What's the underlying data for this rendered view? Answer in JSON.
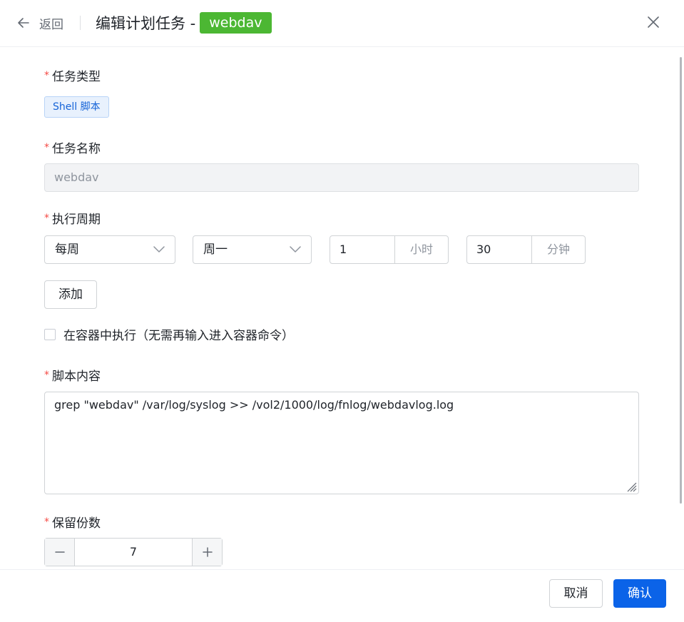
{
  "header": {
    "back_label": "返回",
    "title": "编辑计划任务 -",
    "task_tag": "webdav"
  },
  "form": {
    "task_type": {
      "label": "任务类型",
      "value": "Shell 脚本"
    },
    "task_name": {
      "label": "任务名称",
      "value": "webdav"
    },
    "schedule": {
      "label": "执行周期",
      "frequency": "每周",
      "weekday": "周一",
      "hour_value": "1",
      "hour_unit": "小时",
      "minute_value": "30",
      "minute_unit": "分钟",
      "add_label": "添加"
    },
    "container": {
      "label": "在容器中执行（无需再输入进入容器命令）",
      "checked": false
    },
    "script": {
      "label": "脚本内容",
      "value": "grep \"webdav\" /var/log/syslog >> /vol2/1000/log/fnlog/webdavlog.log"
    },
    "retention": {
      "label": "保留份数",
      "value": "7"
    }
  },
  "footer": {
    "cancel_label": "取消",
    "confirm_label": "确认"
  },
  "colors": {
    "primary": "#0b63e8",
    "tag_green": "#4cb733",
    "required": "#f54a45"
  },
  "icons": [
    "arrow-left-icon",
    "close-icon",
    "chevron-down-icon",
    "minus-icon",
    "plus-icon",
    "resize-handle-icon"
  ]
}
